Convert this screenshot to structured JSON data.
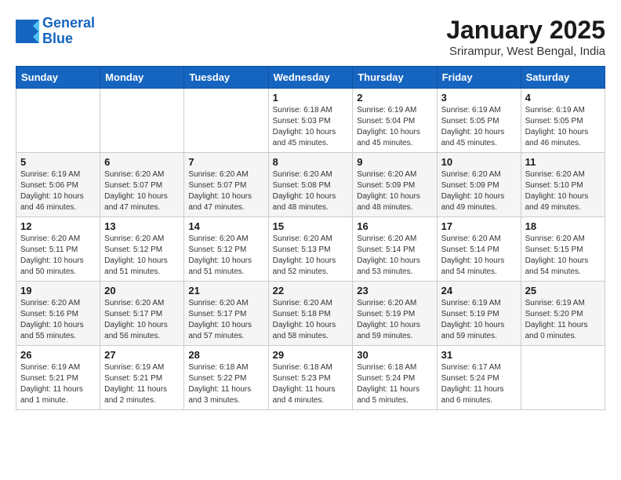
{
  "logo": {
    "line1": "General",
    "line2": "Blue"
  },
  "title": "January 2025",
  "location": "Srirampur, West Bengal, India",
  "days_of_week": [
    "Sunday",
    "Monday",
    "Tuesday",
    "Wednesday",
    "Thursday",
    "Friday",
    "Saturday"
  ],
  "weeks": [
    [
      {
        "day": "",
        "info": ""
      },
      {
        "day": "",
        "info": ""
      },
      {
        "day": "",
        "info": ""
      },
      {
        "day": "1",
        "info": "Sunrise: 6:18 AM\nSunset: 5:03 PM\nDaylight: 10 hours\nand 45 minutes."
      },
      {
        "day": "2",
        "info": "Sunrise: 6:19 AM\nSunset: 5:04 PM\nDaylight: 10 hours\nand 45 minutes."
      },
      {
        "day": "3",
        "info": "Sunrise: 6:19 AM\nSunset: 5:05 PM\nDaylight: 10 hours\nand 45 minutes."
      },
      {
        "day": "4",
        "info": "Sunrise: 6:19 AM\nSunset: 5:05 PM\nDaylight: 10 hours\nand 46 minutes."
      }
    ],
    [
      {
        "day": "5",
        "info": "Sunrise: 6:19 AM\nSunset: 5:06 PM\nDaylight: 10 hours\nand 46 minutes."
      },
      {
        "day": "6",
        "info": "Sunrise: 6:20 AM\nSunset: 5:07 PM\nDaylight: 10 hours\nand 47 minutes."
      },
      {
        "day": "7",
        "info": "Sunrise: 6:20 AM\nSunset: 5:07 PM\nDaylight: 10 hours\nand 47 minutes."
      },
      {
        "day": "8",
        "info": "Sunrise: 6:20 AM\nSunset: 5:08 PM\nDaylight: 10 hours\nand 48 minutes."
      },
      {
        "day": "9",
        "info": "Sunrise: 6:20 AM\nSunset: 5:09 PM\nDaylight: 10 hours\nand 48 minutes."
      },
      {
        "day": "10",
        "info": "Sunrise: 6:20 AM\nSunset: 5:09 PM\nDaylight: 10 hours\nand 49 minutes."
      },
      {
        "day": "11",
        "info": "Sunrise: 6:20 AM\nSunset: 5:10 PM\nDaylight: 10 hours\nand 49 minutes."
      }
    ],
    [
      {
        "day": "12",
        "info": "Sunrise: 6:20 AM\nSunset: 5:11 PM\nDaylight: 10 hours\nand 50 minutes."
      },
      {
        "day": "13",
        "info": "Sunrise: 6:20 AM\nSunset: 5:12 PM\nDaylight: 10 hours\nand 51 minutes."
      },
      {
        "day": "14",
        "info": "Sunrise: 6:20 AM\nSunset: 5:12 PM\nDaylight: 10 hours\nand 51 minutes."
      },
      {
        "day": "15",
        "info": "Sunrise: 6:20 AM\nSunset: 5:13 PM\nDaylight: 10 hours\nand 52 minutes."
      },
      {
        "day": "16",
        "info": "Sunrise: 6:20 AM\nSunset: 5:14 PM\nDaylight: 10 hours\nand 53 minutes."
      },
      {
        "day": "17",
        "info": "Sunrise: 6:20 AM\nSunset: 5:14 PM\nDaylight: 10 hours\nand 54 minutes."
      },
      {
        "day": "18",
        "info": "Sunrise: 6:20 AM\nSunset: 5:15 PM\nDaylight: 10 hours\nand 54 minutes."
      }
    ],
    [
      {
        "day": "19",
        "info": "Sunrise: 6:20 AM\nSunset: 5:16 PM\nDaylight: 10 hours\nand 55 minutes."
      },
      {
        "day": "20",
        "info": "Sunrise: 6:20 AM\nSunset: 5:17 PM\nDaylight: 10 hours\nand 56 minutes."
      },
      {
        "day": "21",
        "info": "Sunrise: 6:20 AM\nSunset: 5:17 PM\nDaylight: 10 hours\nand 57 minutes."
      },
      {
        "day": "22",
        "info": "Sunrise: 6:20 AM\nSunset: 5:18 PM\nDaylight: 10 hours\nand 58 minutes."
      },
      {
        "day": "23",
        "info": "Sunrise: 6:20 AM\nSunset: 5:19 PM\nDaylight: 10 hours\nand 59 minutes."
      },
      {
        "day": "24",
        "info": "Sunrise: 6:19 AM\nSunset: 5:19 PM\nDaylight: 10 hours\nand 59 minutes."
      },
      {
        "day": "25",
        "info": "Sunrise: 6:19 AM\nSunset: 5:20 PM\nDaylight: 11 hours\nand 0 minutes."
      }
    ],
    [
      {
        "day": "26",
        "info": "Sunrise: 6:19 AM\nSunset: 5:21 PM\nDaylight: 11 hours\nand 1 minute."
      },
      {
        "day": "27",
        "info": "Sunrise: 6:19 AM\nSunset: 5:21 PM\nDaylight: 11 hours\nand 2 minutes."
      },
      {
        "day": "28",
        "info": "Sunrise: 6:18 AM\nSunset: 5:22 PM\nDaylight: 11 hours\nand 3 minutes."
      },
      {
        "day": "29",
        "info": "Sunrise: 6:18 AM\nSunset: 5:23 PM\nDaylight: 11 hours\nand 4 minutes."
      },
      {
        "day": "30",
        "info": "Sunrise: 6:18 AM\nSunset: 5:24 PM\nDaylight: 11 hours\nand 5 minutes."
      },
      {
        "day": "31",
        "info": "Sunrise: 6:17 AM\nSunset: 5:24 PM\nDaylight: 11 hours\nand 6 minutes."
      },
      {
        "day": "",
        "info": ""
      }
    ]
  ]
}
